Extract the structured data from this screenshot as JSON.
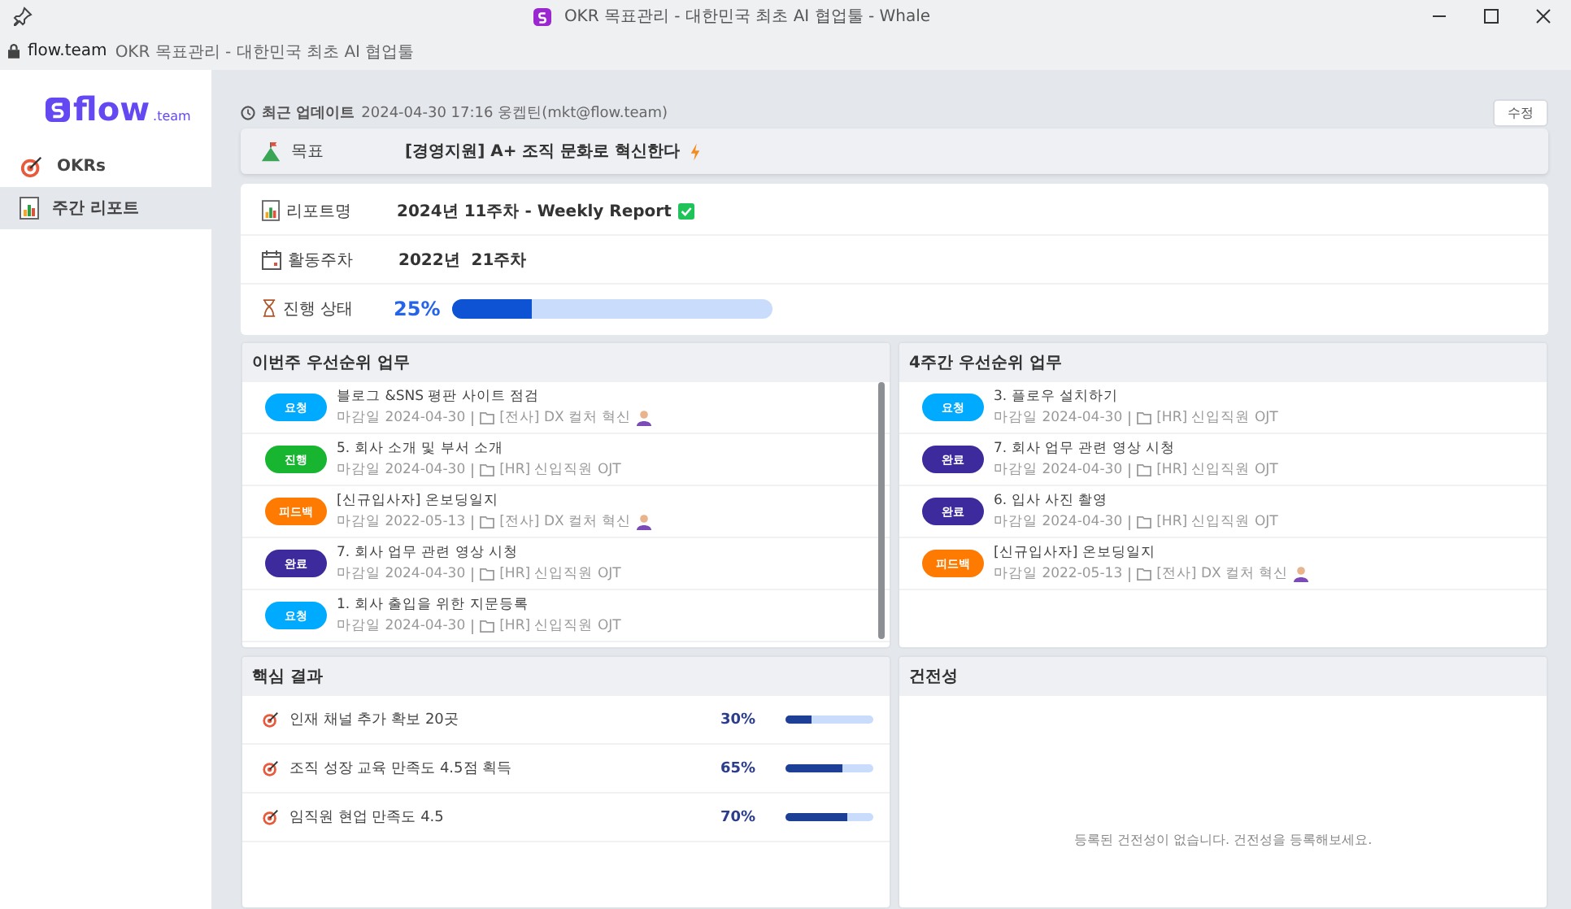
{
  "window": {
    "title": "OKR 목표관리 - 대한민국 최초 AI 협업툴 - Whale"
  },
  "address_bar": {
    "domain": "flow.team",
    "page_title": "OKR 목표관리 - 대한민국 최초 AI 협업툴"
  },
  "sidebar": {
    "logo": "flow",
    "logo_suffix": ".team",
    "items": [
      {
        "label": "OKRs",
        "kind": "target",
        "selected": false
      },
      {
        "label": "주간 리포트",
        "kind": "report",
        "selected": true
      }
    ]
  },
  "update": {
    "label": "최근 업데이트",
    "info": "2024-04-30 17:16 웅켑틴(mkt@flow.team)",
    "edit_button": "수정"
  },
  "objective": {
    "label": "목표",
    "value": "[경영지원] A+ 조직 문화로 혁신한다"
  },
  "report": {
    "name_label": "리포트명",
    "name": "2024년 11주차 - Weekly Report",
    "week_label": "활동주차",
    "week": "2022년  21주차",
    "status_label": "진행 상태",
    "percent": "25%",
    "level": 0.25
  },
  "this_week": {
    "title": "이번주 우선순위 업무",
    "tasks": [
      {
        "status": "요청",
        "color": "#00aaff",
        "title": "블로그 &SNS 평판 사이트 점검",
        "due": "마감일 2024-04-30",
        "project": "[전사] DX 컬처 혁신",
        "avatar": true
      },
      {
        "status": "진행",
        "color": "#17b530",
        "title": "5. 회사 소개 및 부서 소개",
        "due": "마감일 2024-04-30",
        "project": "[HR] 신입직원 OJT",
        "avatar": false
      },
      {
        "status": "피드백",
        "color": "#ff7a00",
        "title": "[신규입사자] 온보딩일지",
        "due": "마감일 2022-05-13",
        "project": "[전사] DX 컬처 혁신",
        "avatar": true
      },
      {
        "status": "완료",
        "color": "#3d2a9c",
        "title": "7. 회사 업무 관련 영상 시청",
        "due": "마감일 2024-04-30",
        "project": "[HR] 신입직원 OJT",
        "avatar": false
      },
      {
        "status": "요청",
        "color": "#00aaff",
        "title": "1. 회사 출입을 위한 지문등록",
        "due": "마감일 2024-04-30",
        "project": "[HR] 신입직원 OJT",
        "avatar": false
      }
    ]
  },
  "four_weeks": {
    "title": "4주간 우선순위 업무",
    "tasks": [
      {
        "status": "요청",
        "color": "#00aaff",
        "title": "3. 플로우 설치하기",
        "due": "마감일 2024-04-30",
        "project": "[HR] 신입직원 OJT",
        "avatar": false
      },
      {
        "status": "완료",
        "color": "#3d2a9c",
        "title": "7. 회사 업무 관련 영상 시청",
        "due": "마감일 2024-04-30",
        "project": "[HR] 신입직원 OJT",
        "avatar": false
      },
      {
        "status": "완료",
        "color": "#3d2a9c",
        "title": "6. 입사 사진 촬영",
        "due": "마감일 2024-04-30",
        "project": "[HR] 신입직원 OJT",
        "avatar": false
      },
      {
        "status": "피드백",
        "color": "#ff7a00",
        "title": "[신규입사자] 온보딩일지",
        "due": "마감일 2022-05-13",
        "project": "[전사] DX 컬처 혁신",
        "avatar": true
      }
    ]
  },
  "key_results": {
    "title": "핵심 결과",
    "items": [
      {
        "label": "인재 채널 추가 확보 20곳",
        "percent": "30%",
        "level": 0.3
      },
      {
        "label": "조직 성장 교육 만족도 4.5점 획득",
        "percent": "65%",
        "level": 0.65
      },
      {
        "label": "임직원 현업 만족도 4.5",
        "percent": "70%",
        "level": 0.7
      }
    ]
  },
  "health": {
    "title": "건전성",
    "empty_message": "등록된 건전성이 없습니다. 건전성을 등록해보세요."
  }
}
